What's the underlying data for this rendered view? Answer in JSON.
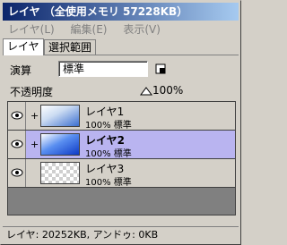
{
  "window": {
    "title": "レイヤ （全使用メモリ 57228KB）"
  },
  "menu": {
    "items": [
      {
        "label": "レイヤ(L)"
      },
      {
        "label": "編集(E)"
      },
      {
        "label": "表示(V)"
      }
    ]
  },
  "tabs": [
    {
      "label": "レイヤ",
      "active": true
    },
    {
      "label": "選択範囲",
      "active": false
    }
  ],
  "properties": {
    "mode_label": "演算",
    "mode_value": "標準",
    "opacity_label": "不透明度",
    "opacity_value": "100%",
    "opacity_percent": 100
  },
  "layers": [
    {
      "name": "レイヤ1",
      "meta": "100% 標準",
      "visible": true,
      "expand": "+",
      "selected": false,
      "thumbnail": "blue-gradient"
    },
    {
      "name": "レイヤ2",
      "meta": "100% 標準",
      "visible": true,
      "expand": "+",
      "selected": true,
      "thumbnail": "blue-gradient"
    },
    {
      "name": "レイヤ3",
      "meta": "100% 標準",
      "visible": true,
      "expand": "",
      "selected": false,
      "thumbnail": "transparent-checker"
    }
  ],
  "status": {
    "text": "レイヤ: 20252KB, アンドゥ: 0KB"
  },
  "colors": {
    "titlebar_start": "#0a246a",
    "titlebar_end": "#a6caf0",
    "selected_layer": "#b9b4f0",
    "panel_bg": "#d4d0c8"
  }
}
